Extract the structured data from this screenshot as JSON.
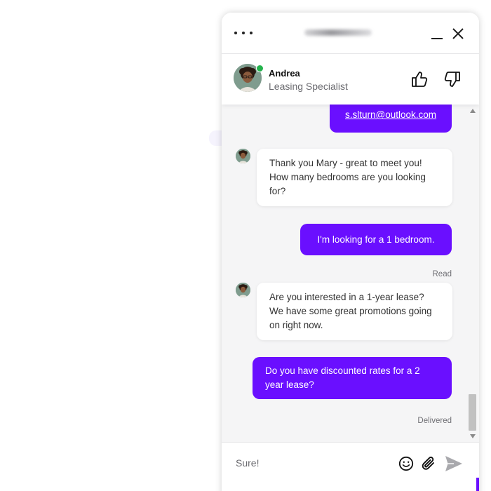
{
  "agent": {
    "name": "Andrea",
    "role": "Leasing Specialist",
    "status": "online"
  },
  "messages": [
    {
      "from": "user",
      "text": "s.slturn@outlook.com",
      "is_link": true
    },
    {
      "from": "agent",
      "text": "Thank you Mary - great to meet you! How many bedrooms are you looking for?"
    },
    {
      "from": "user",
      "text": "I'm looking for a 1 bedroom.",
      "status": "Read"
    },
    {
      "from": "agent",
      "text": "Are you interested in a 1-year lease? We have some great promotions going on right now."
    },
    {
      "from": "user",
      "text": "Do you have discounted rates for a 2 year lease?",
      "status": "Delivered"
    }
  ],
  "composer": {
    "value": "Sure!",
    "placeholder": "Type a message"
  },
  "colors": {
    "accent": "#6a0fff",
    "online": "#24b34d",
    "panel_bg": "#f5f5f6"
  },
  "icons": {
    "menu": "more-horizontal-icon",
    "minimize": "minimize-icon",
    "close": "close-icon",
    "like": "thumbs-up-icon",
    "dislike": "thumbs-down-icon",
    "emoji": "smiley-icon",
    "attach": "paperclip-icon",
    "send": "send-icon"
  }
}
